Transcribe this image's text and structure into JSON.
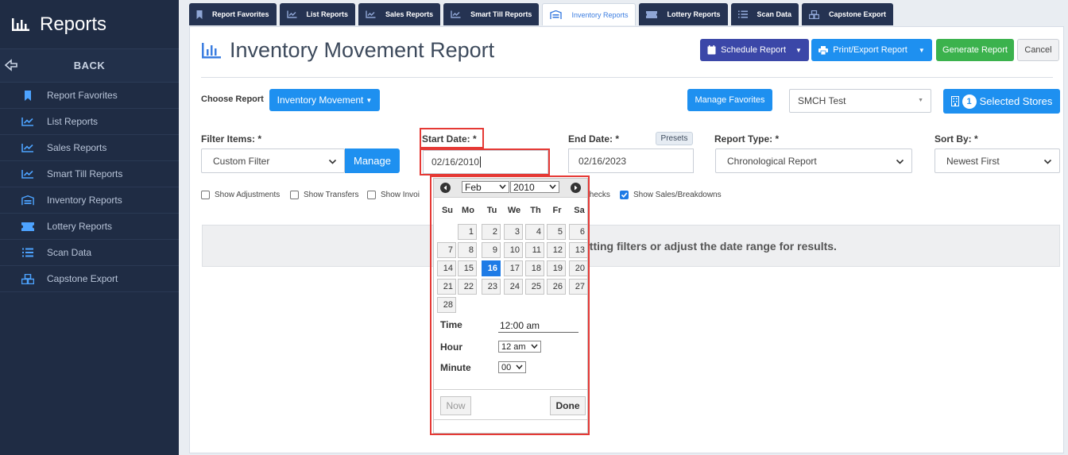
{
  "sidebar": {
    "title": "Reports",
    "back_label": "BACK",
    "items": [
      {
        "label": "Report Favorites",
        "icon": "bookmark-icon"
      },
      {
        "label": "List Reports",
        "icon": "trend-chart-icon"
      },
      {
        "label": "Sales Reports",
        "icon": "trend-chart-icon"
      },
      {
        "label": "Smart Till Reports",
        "icon": "trend-chart-icon"
      },
      {
        "label": "Inventory Reports",
        "icon": "warehouse-icon"
      },
      {
        "label": "Lottery Reports",
        "icon": "ticket-icon"
      },
      {
        "label": "Scan Data",
        "icon": "list-icon"
      },
      {
        "label": "Capstone Export",
        "icon": "boxes-icon"
      }
    ]
  },
  "tabs": [
    {
      "label": "Report Favorites",
      "active": false
    },
    {
      "label": "List Reports",
      "active": false
    },
    {
      "label": "Sales Reports",
      "active": false
    },
    {
      "label": "Smart Till Reports",
      "active": false
    },
    {
      "label": "Inventory Reports",
      "active": true
    },
    {
      "label": "Lottery Reports",
      "active": false
    },
    {
      "label": "Scan Data",
      "active": false
    },
    {
      "label": "Capstone Export",
      "active": false
    }
  ],
  "header": {
    "title": "Inventory Movement Report",
    "schedule_label": "Schedule Report",
    "print_label": "Print/Export Report",
    "generate_label": "Generate Report",
    "cancel_label": "Cancel"
  },
  "choose": {
    "label": "Choose Report",
    "report_value": "Inventory Movement",
    "manage_favorites_label": "Manage Favorites",
    "store_value": "SMCH Test",
    "selected_stores_count": "1",
    "selected_stores_label": "Selected Stores"
  },
  "filters": {
    "filter_items_label": "Filter Items: *",
    "filter_items_value": "Custom Filter",
    "manage_label": "Manage",
    "start_date_label": "Start Date: *",
    "start_date_value": "02/16/2010",
    "end_date_label": "End Date: *",
    "end_date_value": "02/16/2023",
    "presets_label": "Presets",
    "report_type_label": "Report Type: *",
    "report_type_value": "Chronological Report",
    "sort_by_label": "Sort By: *",
    "sort_by_value": "Newest First"
  },
  "checkboxes": [
    {
      "label": "Show Adjustments",
      "checked": false
    },
    {
      "label": "Show Transfers",
      "checked": false
    },
    {
      "label": "Show Invoi",
      "checked": false
    },
    {
      "label": "t Checks",
      "checked": false
    },
    {
      "label": "Show Sales/Breakdowns",
      "checked": true
    }
  ],
  "notice": "etting filters or adjust the date range for results.",
  "datepicker": {
    "month": "Feb",
    "year": "2010",
    "dow": [
      "Su",
      "Mo",
      "Tu",
      "We",
      "Th",
      "Fr",
      "Sa"
    ],
    "first_weekday": 1,
    "days_in_month": 28,
    "selected_day": 16,
    "time_label": "Time",
    "time_value": "12:00 am",
    "hour_label": "Hour",
    "hour_value": "12 am",
    "minute_label": "Minute",
    "minute_value": "00",
    "now_label": "Now",
    "done_label": "Done"
  },
  "colors": {
    "sidebar": "#1f2c44",
    "accent": "#1e90f0",
    "highlight": "#e53935",
    "generate": "#3bb24d",
    "schedule": "#3b47a8"
  }
}
